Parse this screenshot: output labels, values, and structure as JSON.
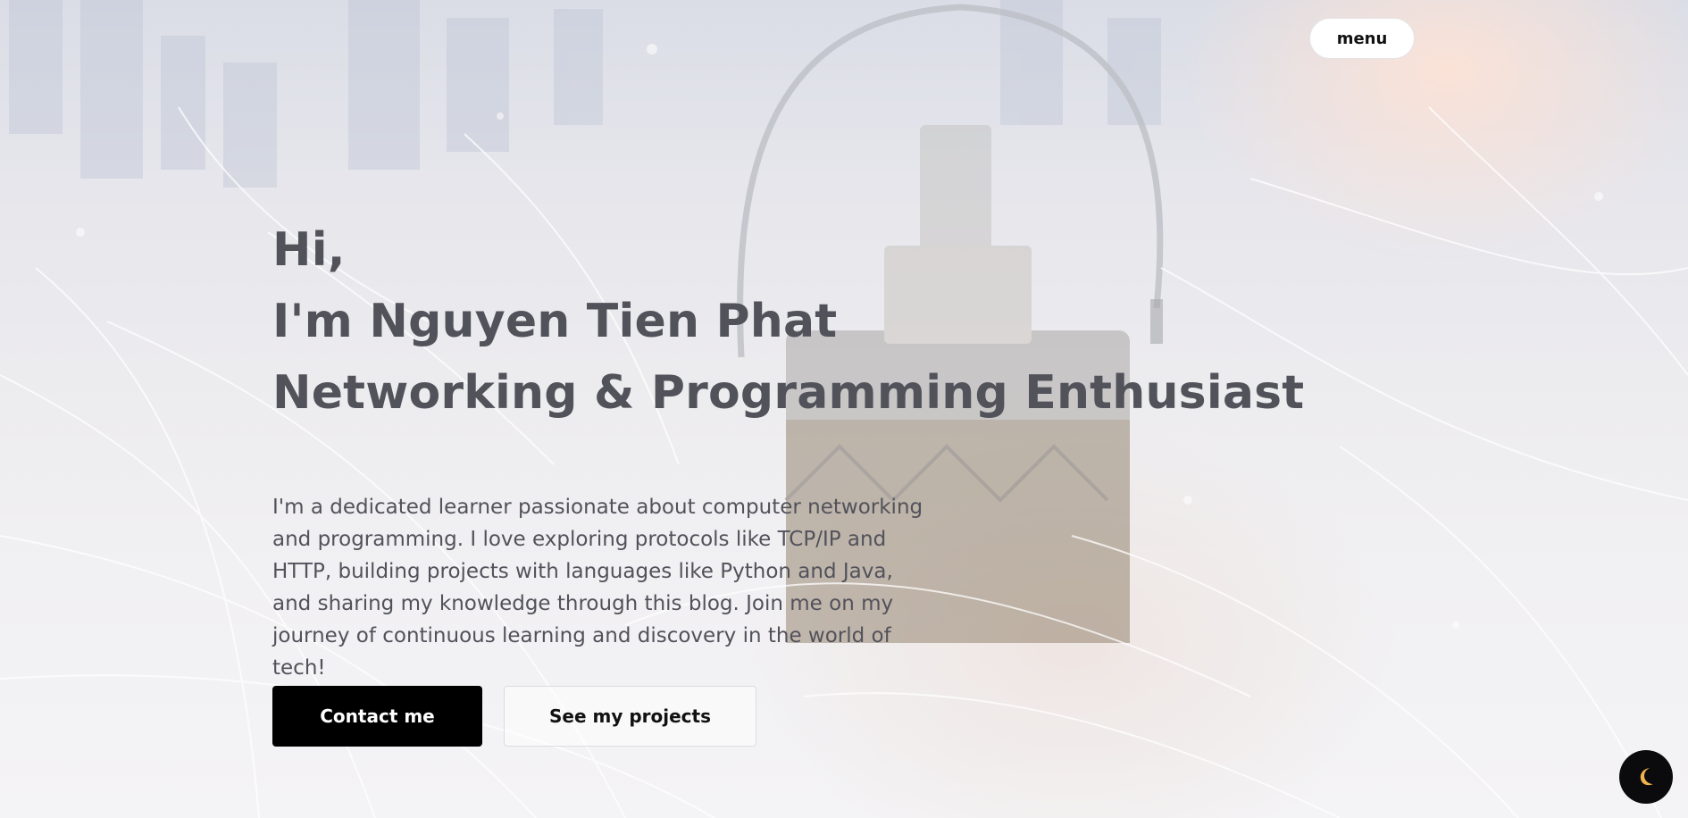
{
  "header": {
    "menu_label": "menu"
  },
  "hero": {
    "greeting": "Hi,",
    "name_line": "I'm Nguyen Tien Phat",
    "role_line": "Networking & Programming Enthusiast",
    "description": "I'm a dedicated learner passionate about computer networking and programming. I love exploring protocols like TCP/IP and HTTP, building projects with languages like Python and Java, and sharing my knowledge through this blog. Join me on my journey of continuous learning and discovery in the world of tech!",
    "primary_button_label": "Contact me",
    "secondary_button_label": "See my projects"
  },
  "theme_toggle": {
    "icon": "moon-icon"
  },
  "colors": {
    "heading_text": "#52525b",
    "primary_button_bg": "#000000",
    "primary_button_text": "#ffffff",
    "moon": "#f2b44a"
  }
}
